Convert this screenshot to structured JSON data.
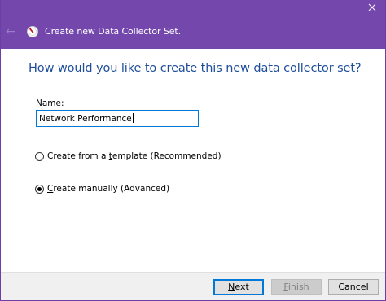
{
  "window": {
    "title": "Create new Data Collector Set."
  },
  "heading": "How would you like to create this new data collector set?",
  "name_field": {
    "label_pre": "Na",
    "label_u": "m",
    "label_post": "e:",
    "value": "Network Performance"
  },
  "options": [
    {
      "pre": "Create from a ",
      "u": "t",
      "post": "emplate (Recommended)",
      "selected": false
    },
    {
      "pre": "",
      "u": "C",
      "post": "reate manually (Advanced)",
      "selected": true
    }
  ],
  "buttons": {
    "next": {
      "u": "N",
      "post": "ext"
    },
    "finish": {
      "u": "F",
      "post": "inish"
    },
    "cancel": {
      "label": "Cancel"
    }
  },
  "colors": {
    "titlebar": "#7447ad",
    "heading": "#1e4e9a",
    "focus": "#0078d7"
  }
}
